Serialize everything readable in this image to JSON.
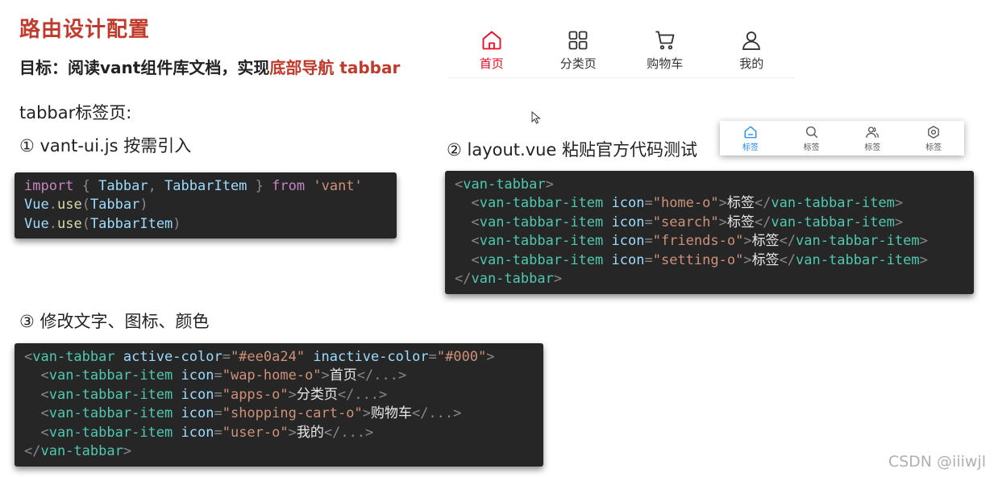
{
  "slide": {
    "title": "路由设计配置",
    "goal_prefix": "目标：阅读vant组件库文档，实现",
    "goal_highlight": "底部导航 tabbar",
    "tabbar_page_label": "tabbar标签页:",
    "step1_label": "① vant-ui.js 按需引入",
    "step2_label": "② layout.vue 粘贴官方代码测试",
    "step3_label": "③ 修改文字、图标、颜色",
    "watermark": "CSDN @iiiwjl"
  },
  "preview_tabbar": {
    "active_color": "#ee0a24",
    "items": [
      {
        "label": "首页",
        "icon": "home-icon",
        "active": true
      },
      {
        "label": "分类页",
        "icon": "apps-icon",
        "active": false
      },
      {
        "label": "购物车",
        "icon": "cart-icon",
        "active": false
      },
      {
        "label": "我的",
        "icon": "user-icon",
        "active": false
      }
    ]
  },
  "default_tabbar": {
    "active_color": "#1989fa",
    "items": [
      {
        "label": "标签",
        "icon": "home-icon",
        "active": true
      },
      {
        "label": "标签",
        "icon": "search-icon",
        "active": false
      },
      {
        "label": "标签",
        "icon": "friends-icon",
        "active": false
      },
      {
        "label": "标签",
        "icon": "gear-icon",
        "active": false
      }
    ]
  },
  "code1": {
    "import_kw": "import",
    "brace_open": "{ ",
    "name1": "Tabbar",
    "comma": ", ",
    "name2": "TabbarItem",
    "brace_close": " }",
    "from_kw": "from",
    "module": "'vant'",
    "vue": "Vue",
    "dot": ".",
    "use": "use",
    "paren_open": "(",
    "paren_close": ")"
  },
  "code2": {
    "lines": [
      {
        "indent": "",
        "open": "<",
        "tag": "van-tabbar",
        "close": ">"
      },
      {
        "indent": "  ",
        "tag": "van-tabbar-item",
        "attr": "icon",
        "value": "\"home-o\"",
        "text": "标签"
      },
      {
        "indent": "  ",
        "tag": "van-tabbar-item",
        "attr": "icon",
        "value": "\"search\"",
        "text": "标签"
      },
      {
        "indent": "  ",
        "tag": "van-tabbar-item",
        "attr": "icon",
        "value": "\"friends-o\"",
        "text": "标签"
      },
      {
        "indent": "  ",
        "tag": "van-tabbar-item",
        "attr": "icon",
        "value": "\"setting-o\"",
        "text": "标签"
      },
      {
        "indent": "",
        "tag": "van-tabbar"
      }
    ]
  },
  "code3": {
    "root_tag": "van-tabbar",
    "attr_active": "active-color",
    "val_active": "\"#ee0a24\"",
    "attr_inactive": "inactive-color",
    "val_inactive": "\"#000\"",
    "item_tag": "van-tabbar-item",
    "attr_icon": "icon",
    "items": [
      {
        "value": "\"wap-home-o\"",
        "text": "首页"
      },
      {
        "value": "\"apps-o\"",
        "text": "分类页"
      },
      {
        "value": "\"shopping-cart-o\"",
        "text": "购物车"
      },
      {
        "value": "\"user-o\"",
        "text": "我的"
      }
    ],
    "ellipsis_close": "</...>"
  }
}
